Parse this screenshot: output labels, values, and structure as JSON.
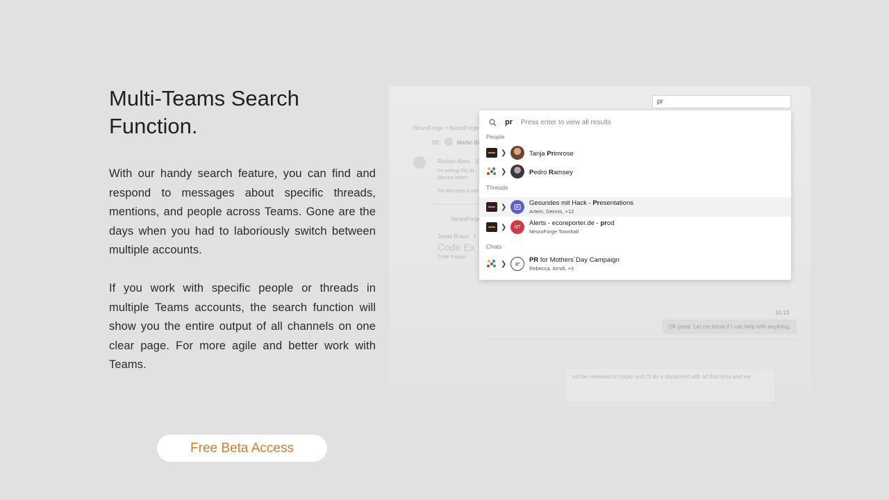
{
  "headline": "Multi-Teams Search Function.",
  "paragraph1": "With our handy search feature, you can find and respond to messages about specific threads, mentions, and people across Teams. Gone are the days when you had to laboriously switch between multiple accounts.",
  "paragraph2": "If you work with specific people or threads in multiple Teams accounts, the search function will show you the entire output of all channels on one clear page. For more agile and better work with Teams.",
  "cta_label": "Free Beta Access",
  "accent_color": "#e07a27",
  "search": {
    "box_value": "pr",
    "query": "pr",
    "hint": "Press  enter to view all results"
  },
  "sections": {
    "people": "People",
    "threads": "Threads",
    "chats": "Chats"
  },
  "people": [
    {
      "pre": "Tanja ",
      "bold": "Pr",
      "post": "imrose",
      "team_icon": "neuroforge-logo",
      "avatar": "photo"
    },
    {
      "pre": "",
      "bold": "P",
      "post": "edro ",
      "bold2": "R",
      "post2": "amsey",
      "team_icon": "star-team-logo",
      "avatar": "photo"
    }
  ],
  "threads": [
    {
      "pre": "Gesundes mit Hack - ",
      "bold": "Pr",
      "post": "esentations",
      "sub": "Artem, Dennis, +12",
      "avatar": "thread-icon"
    },
    {
      "pre": "Alerts - ecoreporter.de - ",
      "bold": "pr",
      "post": "od",
      "sub": "NeuroForge Townhall",
      "avatar_text": "NT"
    }
  ],
  "chats": [
    {
      "bold": "PR",
      "post": " for Mothers´Day Campaign",
      "sub": "Rebecca, Arndt, +3",
      "avatar": "chat-bubble-icon"
    }
  ],
  "background_app": {
    "breadcrumb_1": "NeuroForge",
    "breadcrumb_2": "NeuroForge",
    "re_label": "RE:",
    "re_name": "Martin Br",
    "sender": "Ramon Alves",
    "sender_time": "11",
    "msg_line1": "i'm writing this as",
    "msg_line2": "discuss better.",
    "msg_line3": "For this case a use",
    "breadcrumb_3": "NeuroForge",
    "sender2": "Jonas Braun",
    "sender2_time": "1",
    "code_title": "Code Ex",
    "code_sub": "Code Snippe",
    "time_label": "10:13",
    "bubble_text": "OK great. Let me know if I can help with anything.",
    "bottom_text": "will be released on today and I'll do a document with all this hints and we"
  }
}
